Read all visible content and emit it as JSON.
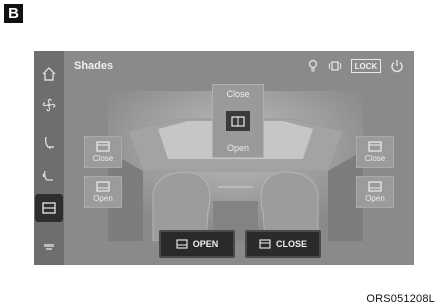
{
  "figure": {
    "marker": "B",
    "caption": "ORS051208L"
  },
  "header": {
    "title": "Shades",
    "lock_label": "LOCK"
  },
  "sidebar": {
    "items": [
      {
        "icon": "home-icon"
      },
      {
        "icon": "fan-icon"
      },
      {
        "icon": "seat-icon"
      },
      {
        "icon": "seat-heat-icon"
      },
      {
        "icon": "shade-icon",
        "active": true
      },
      {
        "icon": "more-icon"
      }
    ]
  },
  "shades": {
    "left_close": "Close",
    "left_open": "Open",
    "right_close": "Close",
    "right_open": "Open",
    "top_close": "Close",
    "top_open": "Open"
  },
  "controls": {
    "open_all": "OPEN",
    "close_all": "CLOSE"
  },
  "colors": {
    "screen_bg": "#8a8a8a",
    "sidebar_bg": "#6e6e6e",
    "button_dark": "#2a2a2a",
    "active_tab": "#2e2e2e"
  }
}
